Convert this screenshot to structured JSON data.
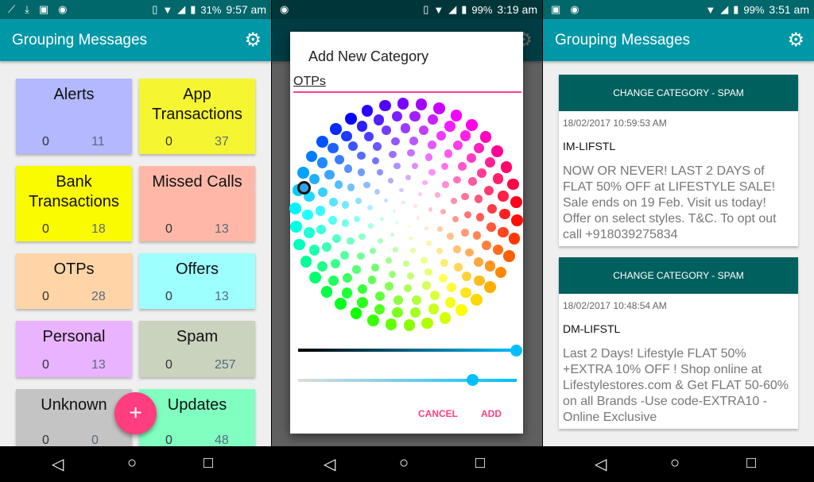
{
  "screens": [
    {
      "status": {
        "time": "9:57 am",
        "battery": "31%"
      },
      "appbar": {
        "title": "Grouping Messages",
        "settings_icon": "gear-icon"
      },
      "tiles": [
        {
          "name": "Alerts",
          "a": "0",
          "b": "11",
          "color": "#b3b8ff"
        },
        {
          "name": "App Transactions",
          "a": "0",
          "b": "37",
          "color": "#f5f531"
        },
        {
          "name": "Bank Transactions",
          "a": "0",
          "b": "18",
          "color": "#fbfb00"
        },
        {
          "name": "Missed Calls",
          "a": "0",
          "b": "13",
          "color": "#ffb8a8"
        },
        {
          "name": "OTPs",
          "a": "0",
          "b": "28",
          "color": "#ffd5a8"
        },
        {
          "name": "Offers",
          "a": "0",
          "b": "13",
          "color": "#9effff"
        },
        {
          "name": "Personal",
          "a": "0",
          "b": "13",
          "color": "#eab3ff"
        },
        {
          "name": "Spam",
          "a": "0",
          "b": "257",
          "color": "#c9d3bd"
        },
        {
          "name": "Unknown",
          "a": "0",
          "b": "0",
          "color": "#c4c4c4"
        },
        {
          "name": "Updates",
          "a": "0",
          "b": "48",
          "color": "#80ffc0"
        }
      ],
      "fab": "+"
    },
    {
      "status": {
        "time": "3:19 am",
        "battery": "99%"
      },
      "dialog": {
        "title": "Add New Category",
        "input_value": "OTPs",
        "cancel": "CANCEL",
        "add": "ADD",
        "lightness_slider": 1.0,
        "alpha_slider": 0.8,
        "selected_color": "#33a3e8"
      }
    },
    {
      "status": {
        "time": "3:51 am",
        "battery": "99%"
      },
      "appbar": {
        "title": "Grouping Messages",
        "settings_icon": "gear-icon"
      },
      "messages": [
        {
          "action": "CHANGE CATEGORY - SPAM",
          "date": "18/02/2017 10:59:53 AM",
          "sender": "IM-LIFSTL",
          "body": "NOW OR NEVER! LAST 2 DAYS of FLAT 50% OFF at LIFESTYLE SALE! Sale ends on 19 Feb. Visit us today! Offer on select styles. T&C. To opt out call +918039275834"
        },
        {
          "action": "CHANGE CATEGORY - SPAM",
          "date": "18/02/2017 10:48:54 AM",
          "sender": "DM-LIFSTL",
          "body": "Last  2 Days! Lifestyle FLAT 50% +EXTRA 10% OFF ! Shop online at Lifestylestores.com & Get FLAT 50-60% on all Brands -Use code-EXTRA10 - Online Exclusive"
        }
      ]
    }
  ],
  "colors": {
    "status": "#00676b",
    "appbar": "#0097a7",
    "accent": "#ff4081",
    "card_header": "#00605e"
  }
}
